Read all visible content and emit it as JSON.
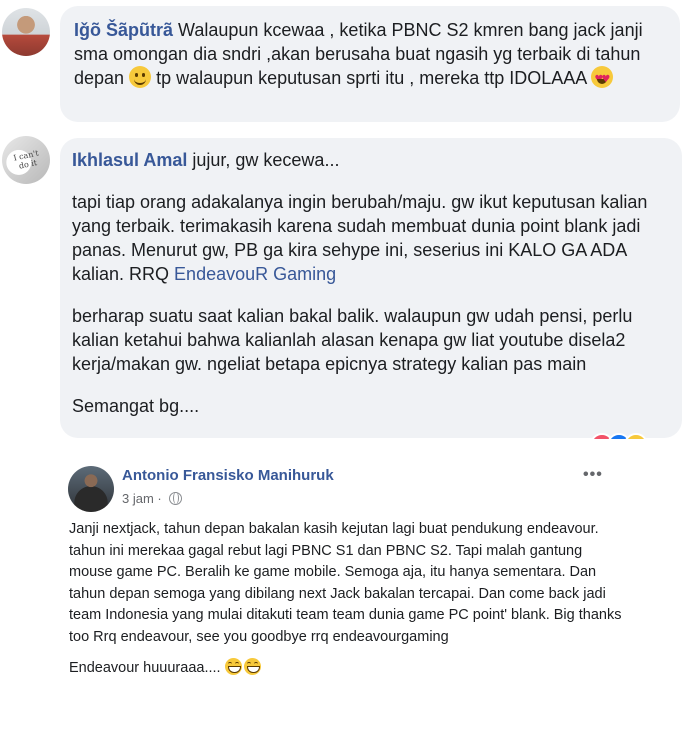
{
  "comments": [
    {
      "author": "Iǧõ Šãpũtrã",
      "parts": {
        "a": " Walaupun kcewaa , ketika PBNC S2 kmren bang jack janji sma omongan dia sndri ,akan berusaha buat ngasih yg terbaik di tahun depan ",
        "b": " tp walaupun keputusan sprti itu , mereka ttp IDOLAAA "
      },
      "emojis": [
        "slightly-smiling-face-emoji",
        "smiling-face-with-heart-eyes-emoji"
      ]
    },
    {
      "author": "Ikhlasul Amal",
      "first_line": " jujur, gw kecewa...",
      "paragraphs": [
        "tapi tiap orang adakalanya ingin berubah/maju. gw ikut keputusan kalian yang terbaik. terimakasih karena sudah membuat dunia point blank jadi panas. Menurut gw, PB ga kira sehype ini, seserius ini KALO GA ADA kalian. RRQ ",
        "berharap suatu saat kalian bakal balik. walaupun gw udah pensi, perlu kalian ketahui bahwa kalianlah alasan kenapa gw liat youtube disela2 kerja/makan gw. ngeliat betapa epicnya strategy kalian pas main",
        "Semangat bg...."
      ],
      "link": "EndeavouR Gaming"
    }
  ],
  "post": {
    "author": "Antonio Fransisko Manihuruk",
    "time": "3 jam · ",
    "body": "Janji nextjack, tahun depan bakalan kasih kejutan lagi buat pendukung endeavour. tahun ini merekaa gagal rebut lagi PBNC S1 dan PBNC S2. Tapi malah gantung mouse game PC. Beralih ke game mobile. Semoga aja, itu hanya sementara. Dan tahun depan semoga yang dibilang next Jack bakalan tercapai. Dan come back jadi team Indonesia yang mulai ditakuti team team dunia game PC point' blank. Big thanks too Rrq endeavour, see you goodbye rrq endeavourgaming",
    "closing": "Endeavour huuuraaa.... ",
    "more_label": "•••"
  },
  "colors": {
    "name_link": "#385898",
    "bubble_bg": "#f0f2f5",
    "meta": "#65676b"
  }
}
